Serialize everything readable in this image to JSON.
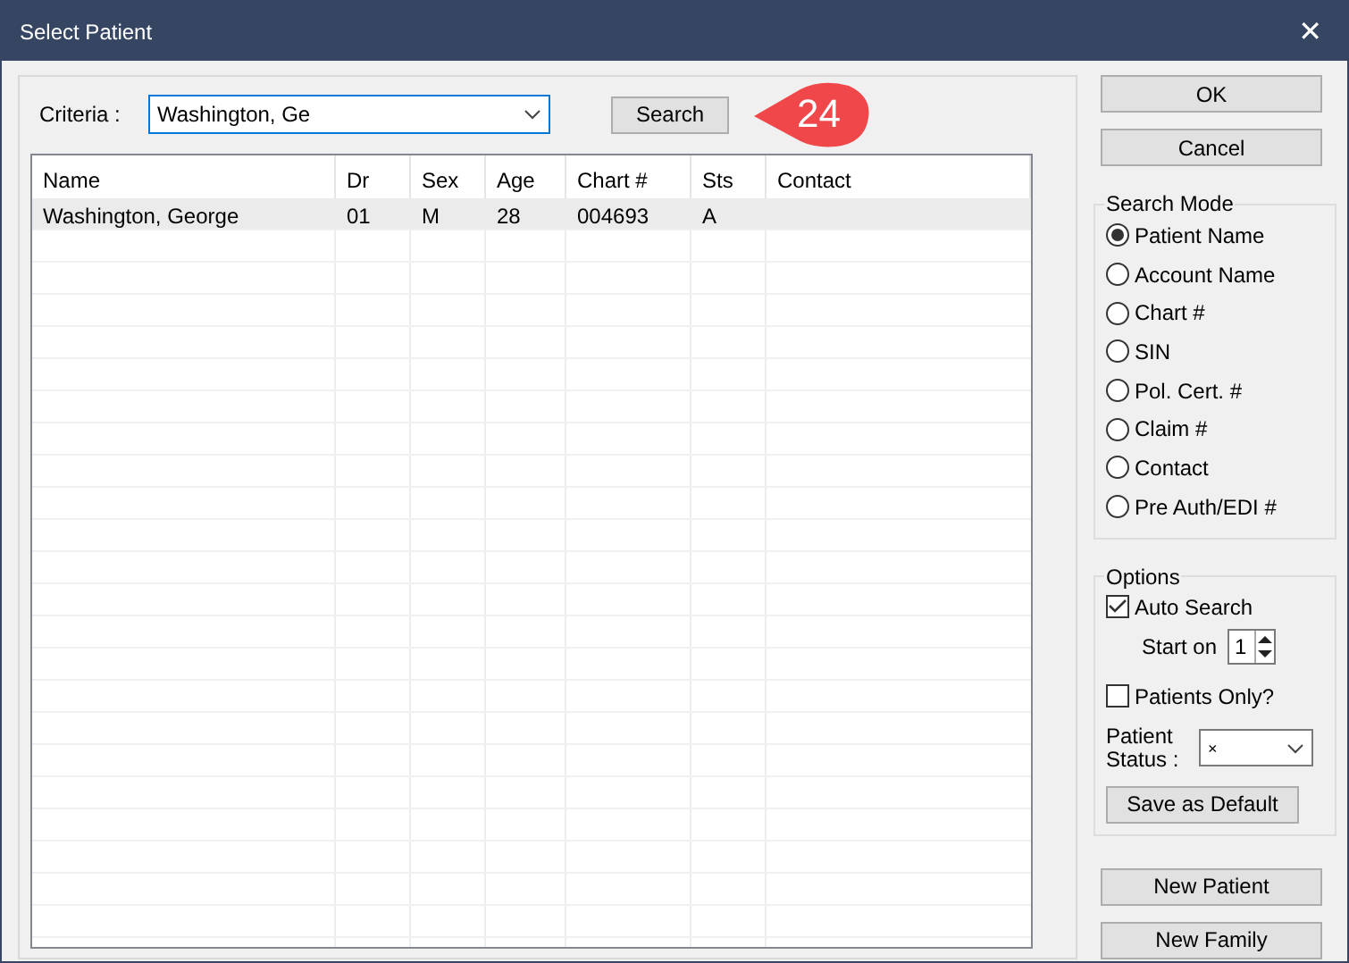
{
  "window": {
    "title": "Select Patient",
    "close": "✕"
  },
  "criteria": {
    "label": "Criteria :",
    "value": "Washington, Ge"
  },
  "search_button": "Search",
  "callout": "24",
  "table": {
    "columns": [
      "Name",
      "Dr",
      "Sex",
      "Age",
      "Chart #",
      "Sts",
      "Contact"
    ],
    "rows": [
      {
        "selected": true,
        "cells": [
          "Washington, George",
          "01",
          "M",
          "28",
          "004693",
          "A",
          ""
        ]
      }
    ]
  },
  "buttons": [
    "OK",
    "Cancel"
  ],
  "search_mode": {
    "title": "Search Mode",
    "options": [
      {
        "label": "Patient Name",
        "selected": true
      },
      {
        "label": "Account Name",
        "selected": false
      },
      {
        "label": "Chart #",
        "selected": false
      },
      {
        "label": "SIN",
        "selected": false
      },
      {
        "label": "Pol. Cert. #",
        "selected": false
      },
      {
        "label": "Claim #",
        "selected": false
      },
      {
        "label": "Contact",
        "selected": false
      },
      {
        "label": "Pre Auth/EDI #",
        "selected": false
      }
    ]
  },
  "options": {
    "title": "Options",
    "auto_search": {
      "label": "Auto Search",
      "checked": true
    },
    "start_on": {
      "label": "Start on",
      "value": "1"
    },
    "patients_only": {
      "label": "Patients Only?",
      "checked": false
    },
    "patient_status": {
      "label": "Patient Status :",
      "value": "×"
    },
    "save_default": "Save as Default"
  },
  "bottom_buttons": [
    "New Patient",
    "New Family"
  ]
}
